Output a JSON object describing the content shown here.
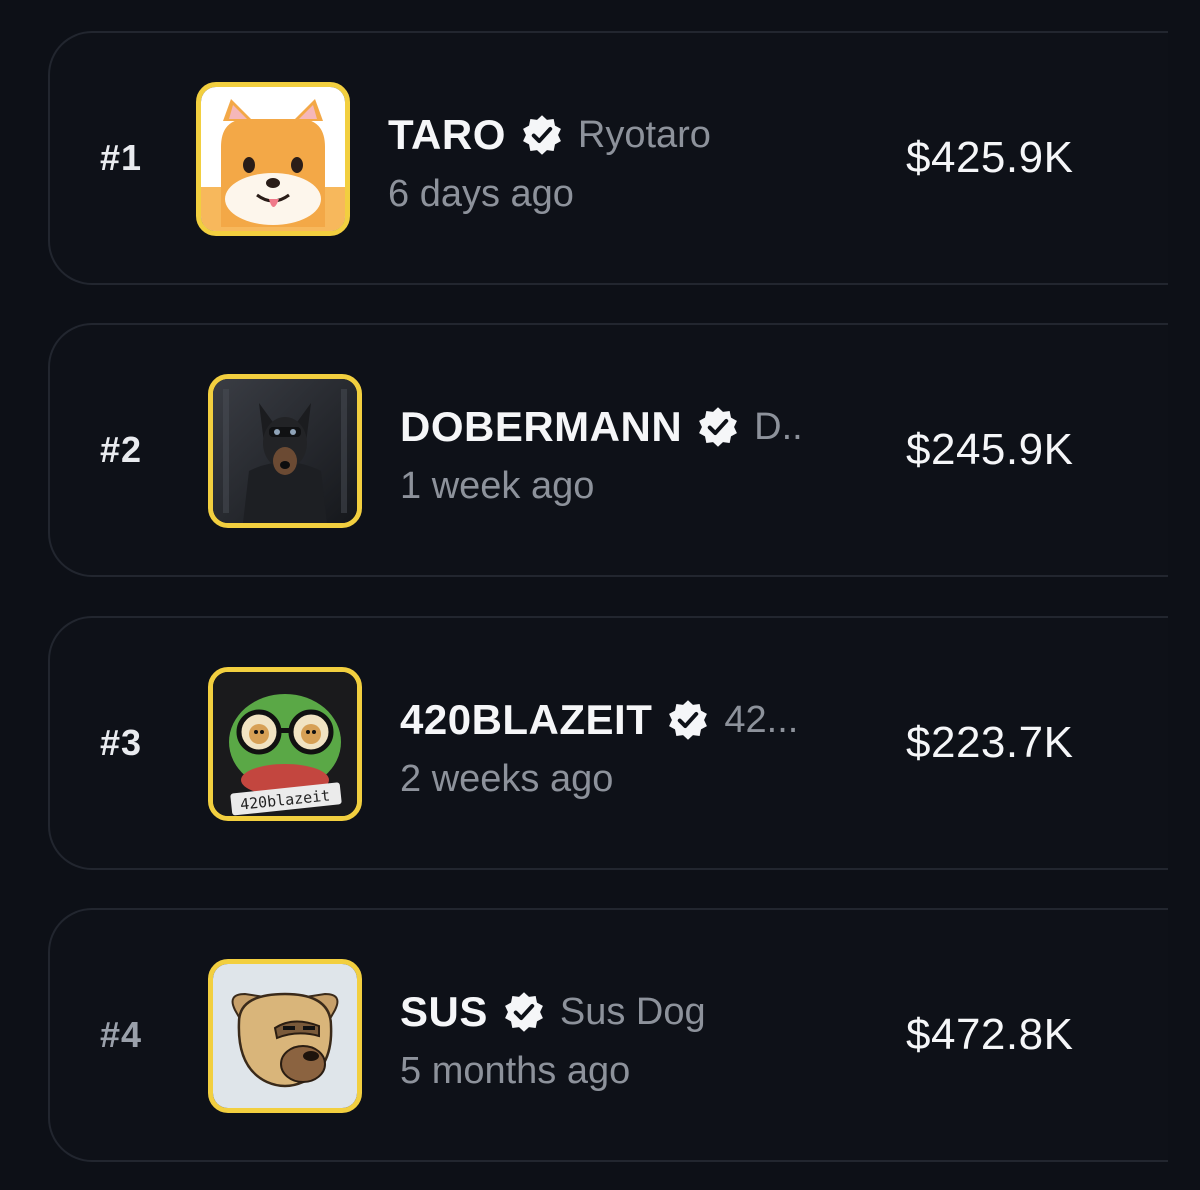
{
  "tokens": [
    {
      "rank": "#1",
      "ticker": "TARO",
      "creator": "Ryotaro",
      "age": "6 days ago",
      "market_cap": "$425.9K",
      "avatar_icon": "shiba-dog-avatar-icon"
    },
    {
      "rank": "#2",
      "ticker": "DOBERMANN",
      "creator": "D..",
      "age": "1 week ago",
      "market_cap": "$245.9K",
      "avatar_icon": "dobermann-dog-avatar-icon"
    },
    {
      "rank": "#3",
      "ticker": "420BLAZEIT",
      "creator": "42...",
      "age": "2 weeks ago",
      "market_cap": "$223.7K",
      "avatar_icon": "frog-with-glasses-avatar-icon",
      "avatar_text": "420blazeit"
    },
    {
      "rank": "#4",
      "ticker": "SUS",
      "creator": "Sus Dog",
      "age": "5 months ago",
      "market_cap": "$472.8K",
      "avatar_icon": "sus-dog-avatar-icon"
    }
  ],
  "colors": {
    "background": "#0d1017",
    "card_border": "#22262f",
    "avatar_border": "#f2cf3f",
    "primary_text": "#f5f6f8",
    "secondary_text": "#8d929b"
  }
}
